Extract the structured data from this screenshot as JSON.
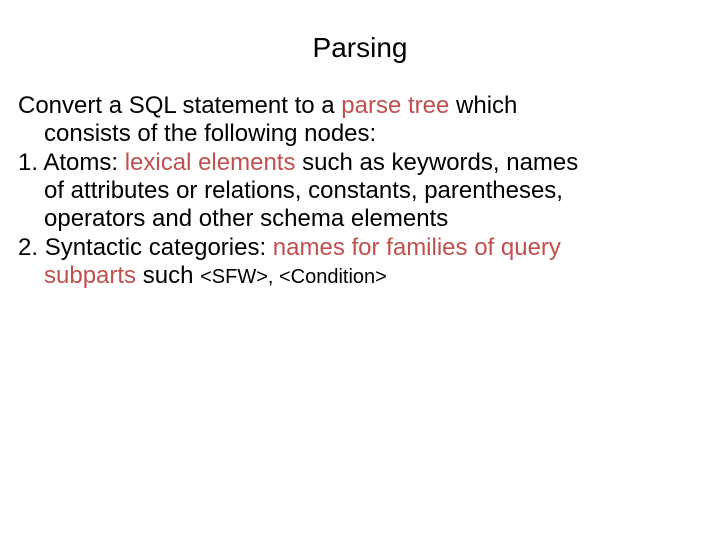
{
  "title": "Parsing",
  "intro": {
    "line1_pre": "Convert  a SQL statement to a ",
    "line1_accent": "parse tree",
    "line1_post": " which",
    "line2": "consists of  the following nodes:"
  },
  "item1": {
    "num": "1. ",
    "label": "Atoms: ",
    "accent": "lexical elements",
    "rest_line1": " such as keywords, names",
    "rest_line2": "of attributes or relations, constants, parentheses,",
    "rest_line3": "operators and other schema elements"
  },
  "item2": {
    "num": "2. ",
    "label": "Syntactic categories: ",
    "accent1": "names for families of query",
    "accent2_line2_pre": "subparts",
    "rest_line2_mid": " such ",
    "small1": "<SFW>, <Condition>"
  }
}
